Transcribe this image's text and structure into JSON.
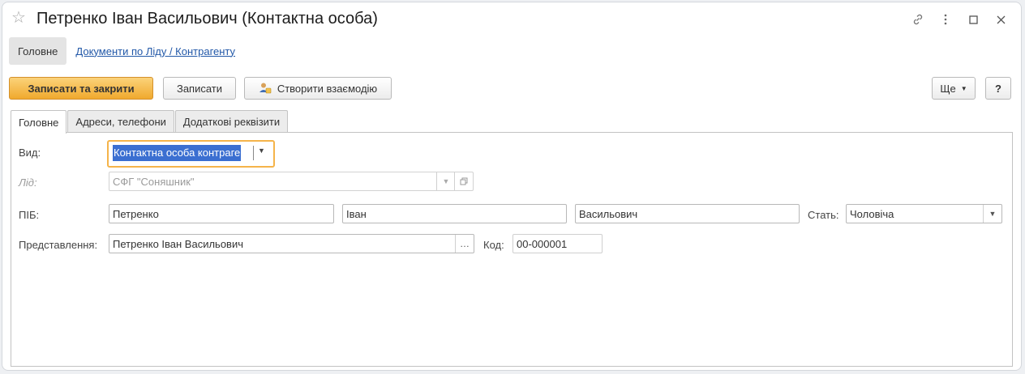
{
  "window": {
    "title": "Петренко Іван Васильович (Контактна особа)"
  },
  "navbar": {
    "main_label": "Головне",
    "docs_link": "Документи по Ліду / Контрагенту"
  },
  "toolbar": {
    "save_close_label": "Записати та закрити",
    "save_label": "Записати",
    "create_interaction_label": "Створити взаємодію",
    "more_label": "Ще",
    "help_label": "?"
  },
  "tabs": [
    {
      "label": "Головне"
    },
    {
      "label": "Адреси, телефони"
    },
    {
      "label": "Додаткові реквізити"
    }
  ],
  "form": {
    "vid_label": "Вид:",
    "vid_value": "Контактна особа контраге",
    "lid_label": "Лід:",
    "lid_value": "СФГ \"Соняшник\"",
    "pib_label": "ПІБ:",
    "last_name": "Петренко",
    "first_name": "Іван",
    "middle_name": "Васильович",
    "gender_label": "Стать:",
    "gender_value": "Чоловіча",
    "presentation_label": "Представлення:",
    "presentation_value": "Петренко Іван Васильович",
    "code_label": "Код:",
    "code_value": "00-000001"
  },
  "colors": {
    "primary_button": "#f0a92e",
    "link": "#2258a8",
    "focus_border": "#f5b44a",
    "selection": "#3b6fd1"
  }
}
